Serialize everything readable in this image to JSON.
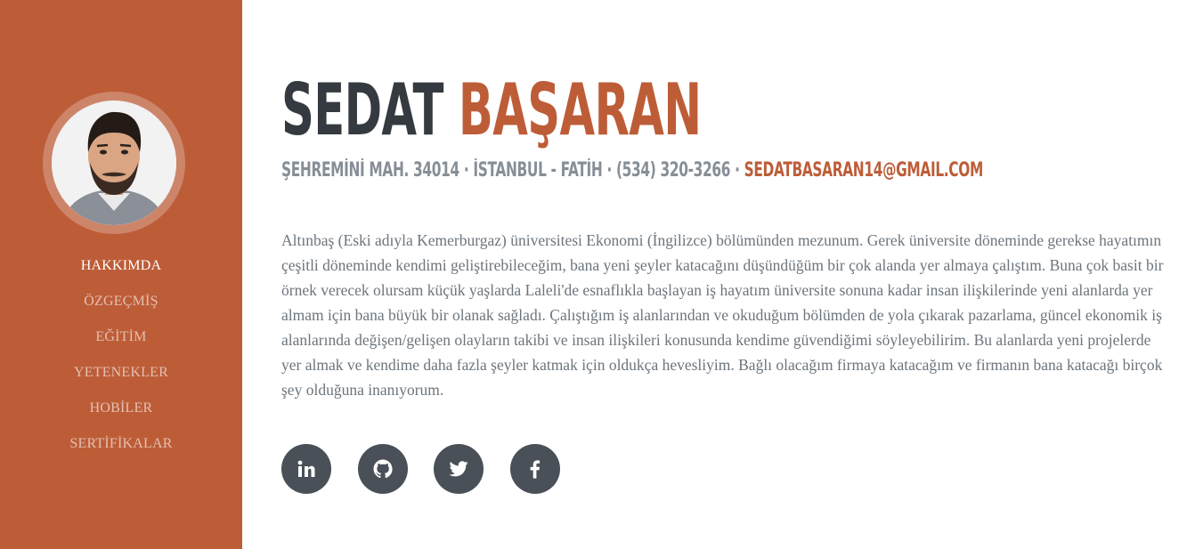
{
  "sidebar": {
    "nav": [
      {
        "label": "HAKKIMDA",
        "active": true
      },
      {
        "label": "ÖZGEÇMİŞ",
        "active": false
      },
      {
        "label": "EĞİTİM",
        "active": false
      },
      {
        "label": "YETENEKLER",
        "active": false
      },
      {
        "label": "HOBİLER",
        "active": false
      },
      {
        "label": "SERTİFİKALAR",
        "active": false
      }
    ]
  },
  "header": {
    "first_name": "SEDAT",
    "last_name": "BAŞARAN",
    "address": "ŞEHREMİNİ MAH. 34014 · İSTANBUL - FATİH · (534) 320-3266 · ",
    "email": "SEDATBASARAN14@GMAIL.COM"
  },
  "about": {
    "text": "Altınbaş (Eski adıyla Kemerburgaz) üniversitesi Ekonomi (İngilizce) bölümünden mezunum. Gerek üniversite döneminde gerekse hayatımın çeşitli döneminde kendimi geliştirebileceğim, bana yeni şeyler katacağını düşündüğüm bir çok alanda yer almaya çalıştım. Buna çok basit bir örnek verecek olursam küçük yaşlarda Laleli'de esnaflıkla başlayan iş hayatım üniversite sonuna kadar insan ilişkilerinde yeni alanlarda yer almam için bana büyük bir olanak sağladı. Çalıştığım iş alanlarından ve okuduğum bölümden de yola çıkarak pazarlama, güncel ekonomik iş alanlarında değişen/gelişen olayların takibi ve insan ilişkileri konusunda kendime güvendiğimi söyleyebilirim. Bu alanlarda yeni projelerde yer almak ve kendime daha fazla şeyler katmak için oldukça hevesliyim. Bağlı olacağım firmaya katacağım ve firmanın bana katacağı birçok şey olduğuna inanıyorum."
  },
  "social_icons": [
    "linkedin-icon",
    "github-icon",
    "twitter-icon",
    "facebook-icon"
  ],
  "colors": {
    "accent": "#bd5d38",
    "dark": "#343a40",
    "muted": "#868e96",
    "social_bg": "#495057"
  }
}
